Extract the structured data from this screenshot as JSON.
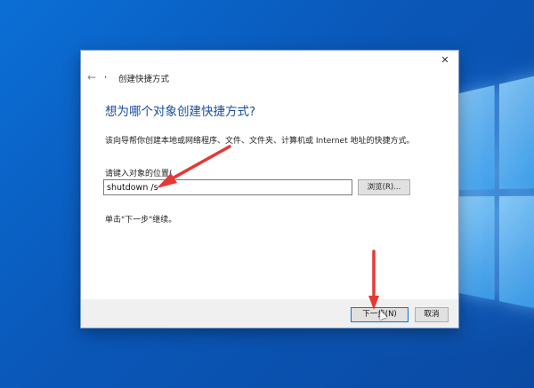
{
  "dialog": {
    "title": "创建快捷方式",
    "title_icon": ",",
    "back_symbol": "←",
    "close_symbol": "✕",
    "heading": "想为哪个对象创建快捷方式?",
    "description": "该向导帮你创建本地或网络程序、文件、文件夹、计算机或 Internet 地址的快捷方式。",
    "field_label": "请键入对象的位置(",
    "location_value": "shutdown /s",
    "browse_label": "浏览(R)...",
    "continue_text": "单击\"下一步\"继续。",
    "next_label": "下一步(N)",
    "cancel_label": "取消"
  },
  "colors": {
    "annotation_arrow": "#e53935",
    "heading": "#1a4fa0",
    "desktop": "#0a5fc8"
  },
  "icons": [
    "back-arrow-icon",
    "shortcut-icon",
    "close-icon",
    "mouse-cursor-icon",
    "windows-logo"
  ]
}
